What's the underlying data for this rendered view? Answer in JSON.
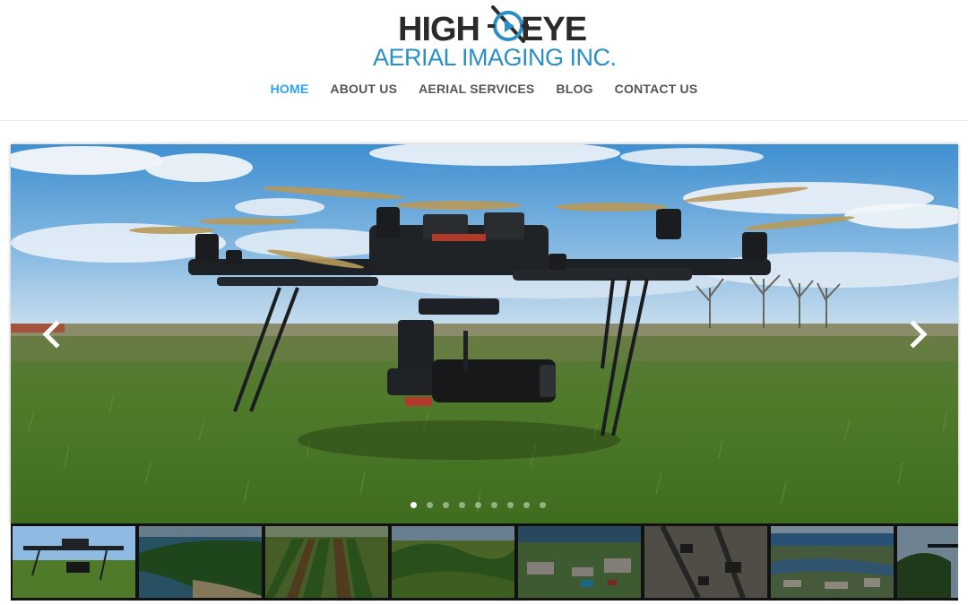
{
  "brand": {
    "name_line1_left": "HIGH",
    "name_line1_right": "EYE",
    "name_line2": "AERIAL IMAGING INC.",
    "colors": {
      "dark": "#2b2b2b",
      "blue": "#2a8fc4"
    }
  },
  "nav": {
    "items": [
      {
        "label": "HOME",
        "active": true
      },
      {
        "label": "ABOUT US",
        "active": false
      },
      {
        "label": "AERIAL SERVICES",
        "active": false
      },
      {
        "label": "BLOG",
        "active": false
      },
      {
        "label": "CONTACT US",
        "active": false
      }
    ],
    "active_color": "#2ea3f2"
  },
  "slider": {
    "current_slide": 1,
    "total_slides": 9,
    "prev_icon": "chevron-left-icon",
    "next_icon": "chevron-right-icon"
  },
  "thumbnails": [
    {
      "subject": "drone-on-grass"
    },
    {
      "subject": "forest-shoreline"
    },
    {
      "subject": "crop-field-rows"
    },
    {
      "subject": "green-hills-valley"
    },
    {
      "subject": "town-aerial"
    },
    {
      "subject": "industrial-site"
    },
    {
      "subject": "coastal-town"
    },
    {
      "subject": "drone-in-trees"
    }
  ]
}
